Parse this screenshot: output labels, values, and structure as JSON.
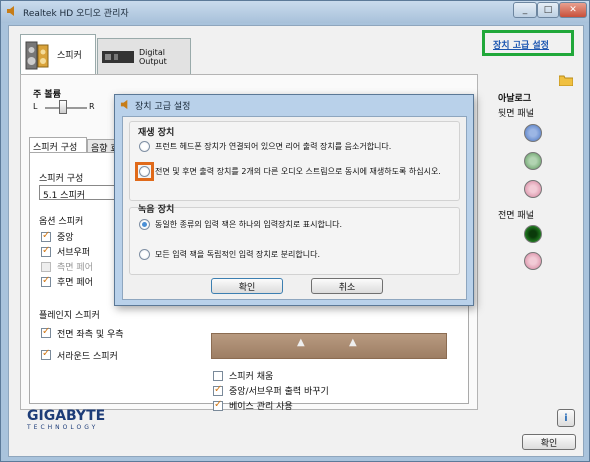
{
  "window": {
    "title": "Realtek HD 오디오 관리자"
  },
  "device_tabs": [
    {
      "label": "스피커"
    },
    {
      "label": "Digital Output"
    }
  ],
  "advanced_link": "장치 고급 설정",
  "volume": {
    "label": "주 볼륨",
    "left": "L",
    "right": "R"
  },
  "inner_tabs": [
    {
      "label": "스피커 구성"
    },
    {
      "label": "음향 효"
    }
  ],
  "speaker_config": {
    "label": "스피커 구성",
    "selected": "5.1 스피커"
  },
  "full_range": {
    "label": "옵션 스피커",
    "items": [
      {
        "label": "중앙",
        "checked": true,
        "enabled": true
      },
      {
        "label": "서브우퍼",
        "checked": true,
        "enabled": true
      },
      {
        "label": "측면 페어",
        "checked": false,
        "enabled": false
      },
      {
        "label": "후면 페어",
        "checked": true,
        "enabled": true
      }
    ]
  },
  "virtual_surround": {
    "label": "플레인지 스피커",
    "items": [
      {
        "label": "전면 좌측 및 우측",
        "checked": true
      },
      {
        "label": "서라운드 스피커",
        "checked": true
      }
    ]
  },
  "bottom_options": [
    {
      "label": "스피커 채움",
      "checked": false
    },
    {
      "label": "중앙/서브우퍼 출력 바꾸기",
      "checked": true
    },
    {
      "label": "베이스 관리 사용",
      "checked": true
    }
  ],
  "analog": {
    "title": "아날로그",
    "back_panel": "뒷면 패널",
    "front_panel": "전면 패널",
    "back_jacks": [
      "#6b8fd0",
      "#7fb07f",
      "#e0a0b4"
    ],
    "front_jacks": [
      "#1f7a1f",
      "#e0a0b4"
    ]
  },
  "brand": {
    "name": "GIGABYTE",
    "tagline": "TECHNOLOGY"
  },
  "ok_button": "확인",
  "dialog": {
    "title": "장치 고급 설정",
    "playback": {
      "title": "재생 장치",
      "option1": "프런트 헤드폰 장치가 연결되어 있으면 리어 출력 장치를 음소거합니다.",
      "option2": "전면 및 후면 출력 장치를 2개의 다른 오디오 스트림으로 동시에 재생하도록 하십시오."
    },
    "recording": {
      "title": "녹음 장치",
      "option1": "동일한 종류의 입력 잭은 하나의 입력장치로 표시합니다.",
      "option2": "모든 입력 잭을 독립적인 입력 장치로 분리합니다."
    },
    "ok": "확인",
    "cancel": "취소"
  }
}
